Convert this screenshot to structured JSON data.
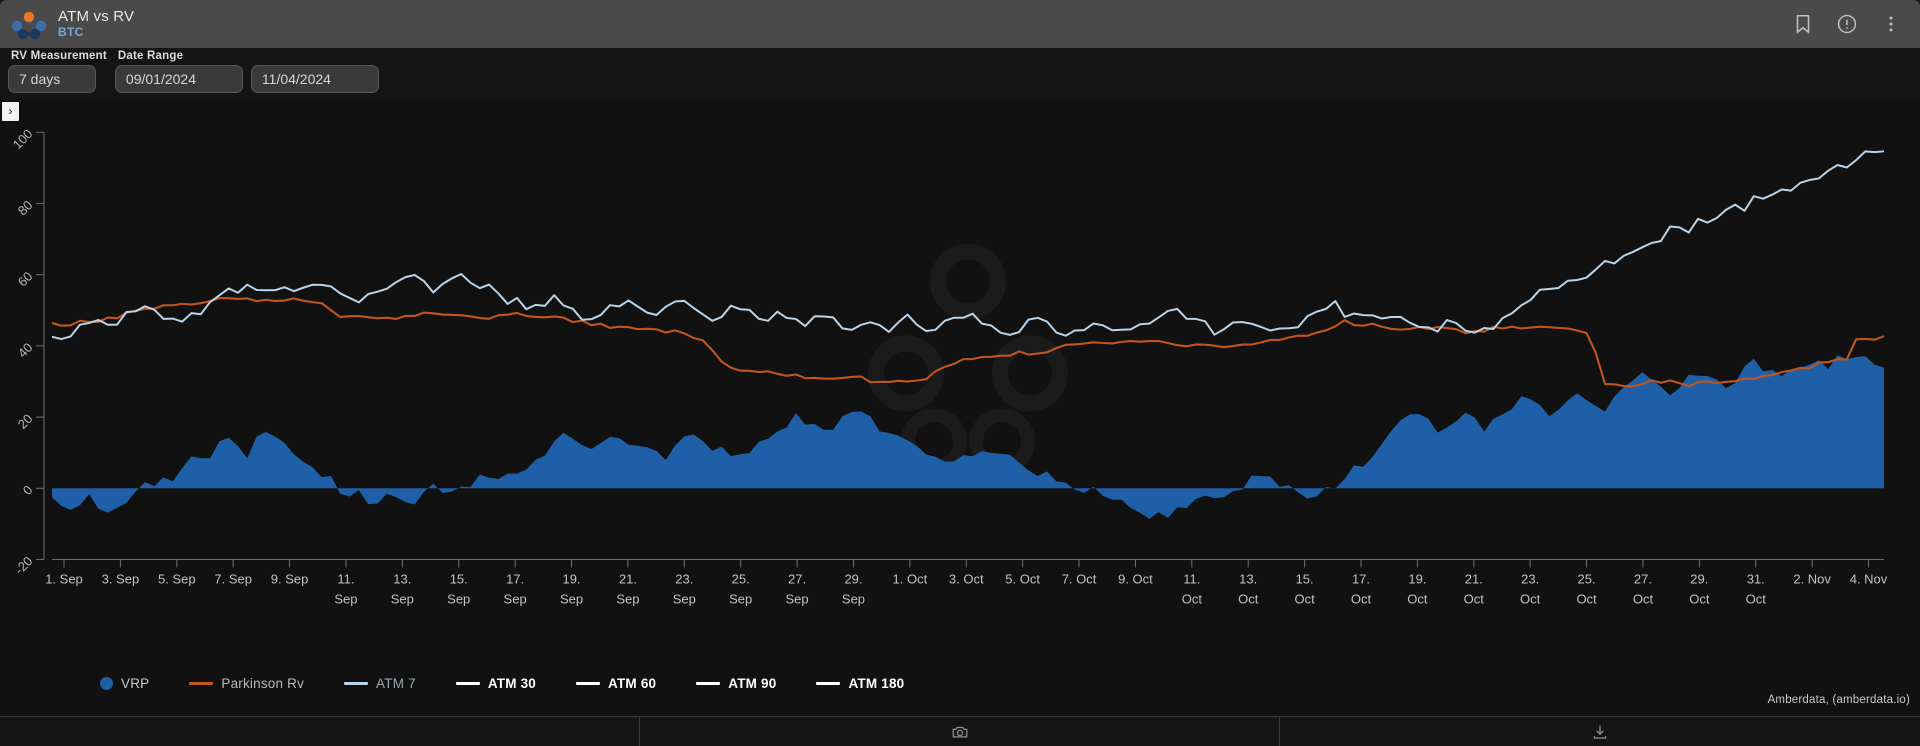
{
  "titlebar": {
    "logo_icon": "amberdata-molecule-logo",
    "title": "ATM vs RV",
    "subtitle": "BTC",
    "actions": [
      {
        "icon": "bookmark-icon",
        "name": "bookmark-button"
      },
      {
        "icon": "alert-circle-icon",
        "name": "info-button"
      },
      {
        "icon": "more-vertical-icon",
        "name": "overflow-menu-button"
      }
    ]
  },
  "controls": {
    "rv_measurement": {
      "label": "RV Measurement",
      "value": "7 days",
      "placeholder": "7 days"
    },
    "date_range": {
      "label": "Date Range",
      "start_value": "09/01/2024",
      "end_value": "11/04/2024",
      "start_placeholder": "MM/DD/YYYY",
      "end_placeholder": "MM/DD/YYYY"
    }
  },
  "panel_expander": {
    "glyph": "›",
    "name": "expand-left-panel"
  },
  "credit": "Amberdata, (amberdata.io)",
  "bottombar": {
    "cells": [
      {
        "name": "status-cell",
        "icon": ""
      },
      {
        "name": "screenshot-button",
        "icon": "camera-icon"
      },
      {
        "name": "download-button",
        "icon": "download-icon"
      }
    ]
  },
  "legend": {
    "position": "bottom-left",
    "items": [
      {
        "label": "VRP",
        "color": "#1f5fa8",
        "marker": "dot",
        "text_color": "#c9c9c9"
      },
      {
        "label": "Parkinson Rv",
        "color": "#c0551f",
        "marker": "line",
        "text_color": "#b8b8b8"
      },
      {
        "label": "ATM 7",
        "color": "#b9d4ea",
        "marker": "line",
        "text_color": "#9aa6ad"
      },
      {
        "label": "ATM 30",
        "color": "#ffffff",
        "marker": "line",
        "text_color": "#ffffff"
      },
      {
        "label": "ATM 60",
        "color": "#ffffff",
        "marker": "line",
        "text_color": "#ffffff"
      },
      {
        "label": "ATM 90",
        "color": "#ffffff",
        "marker": "line",
        "text_color": "#ffffff"
      },
      {
        "label": "ATM 180",
        "color": "#ffffff",
        "marker": "line",
        "text_color": "#ffffff"
      }
    ]
  },
  "chart_data": {
    "type": "line",
    "title": "ATM vs RV",
    "subtitle": "BTC",
    "xlabel": "",
    "ylabel": "",
    "ylim": [
      -28,
      104
    ],
    "yticks": [
      -20,
      0,
      20,
      40,
      60,
      80,
      100
    ],
    "ytick_labels": [
      "-20",
      "0",
      "20",
      "40",
      "60",
      "80",
      "100"
    ],
    "ytick_rotation_deg": -45,
    "grid": false,
    "xtick_labels": [
      "1. Sep",
      "3. Sep",
      "5. Sep",
      "7. Sep",
      "9. Sep",
      "11. Sep",
      "13. Sep",
      "15. Sep",
      "17. Sep",
      "19. Sep",
      "21. Sep",
      "23. Sep",
      "25. Sep",
      "27. Sep",
      "29. Sep",
      "1. Oct",
      "3. Oct",
      "5. Oct",
      "7. Oct",
      "9. Oct",
      "11. Oct",
      "13. Oct",
      "15. Oct",
      "17. Oct",
      "19. Oct",
      "21. Oct",
      "23. Oct",
      "25. Oct",
      "27. Oct",
      "29. Oct",
      "31. Oct",
      "2. Nov",
      "4. Nov"
    ],
    "x_range": [
      "2024-09-01",
      "2024-11-04"
    ],
    "series": [
      {
        "name": "VRP",
        "type": "area",
        "color": "#1f5fa8",
        "baseline": 0,
        "values": [
          -3,
          -4,
          -5,
          -4,
          -3,
          -5,
          -6,
          -4,
          -3,
          -2,
          1,
          2,
          4,
          3,
          5,
          8,
          7,
          9,
          12,
          14,
          11,
          9,
          13,
          16,
          14,
          12,
          10,
          8,
          6,
          4,
          2,
          -1,
          -3,
          -2,
          -4,
          -5,
          -3,
          -2,
          -4,
          -3,
          -1,
          1,
          0,
          -2,
          -1,
          1,
          3,
          2,
          4,
          3,
          5,
          6,
          8,
          10,
          12,
          14,
          13,
          11,
          12,
          14,
          16,
          15,
          13,
          12,
          11,
          10,
          9,
          11,
          13,
          15,
          14,
          12,
          11,
          9,
          8,
          10,
          12,
          14,
          16,
          18,
          20,
          19,
          17,
          16,
          18,
          20,
          22,
          21,
          19,
          17,
          15,
          14,
          13,
          12,
          11,
          10,
          9,
          8,
          9,
          10,
          11,
          10,
          9,
          8,
          7,
          6,
          5,
          4,
          3,
          2,
          1,
          0,
          -1,
          -2,
          -3,
          -4,
          -5,
          -6,
          -7,
          -8,
          -7,
          -6,
          -5,
          -4,
          -3,
          -2,
          -1,
          0,
          1,
          2,
          3,
          2,
          1,
          0,
          -1,
          -2,
          -1,
          0,
          1,
          3,
          5,
          7,
          9,
          12,
          15,
          18,
          20,
          22,
          19,
          17,
          16,
          18,
          20,
          19,
          17,
          19,
          21,
          23,
          25,
          24,
          22,
          21,
          23,
          25,
          27,
          26,
          24,
          23,
          25,
          27,
          29,
          31,
          30,
          28,
          27,
          29,
          31,
          33,
          32,
          30,
          29,
          31,
          33,
          35,
          34,
          32,
          31,
          33,
          35,
          34,
          36,
          35,
          37,
          36,
          38,
          37,
          36,
          35
        ]
      },
      {
        "name": "Parkinson Rv",
        "type": "line",
        "color": "#c0551f",
        "values": [
          46,
          46,
          46,
          47,
          47,
          47,
          48,
          48,
          49,
          50,
          50,
          50,
          51,
          51,
          52,
          52,
          52,
          52,
          53,
          53,
          53,
          53,
          53,
          53,
          53,
          53,
          53,
          53,
          53,
          52,
          52,
          48,
          48,
          48,
          48,
          48,
          48,
          48,
          48,
          48,
          49,
          49,
          49,
          49,
          49,
          49,
          48,
          48,
          48,
          49,
          49,
          49,
          48,
          48,
          48,
          48,
          48,
          47,
          47,
          46,
          46,
          45,
          45,
          45,
          45,
          45,
          45,
          44,
          44,
          44,
          43,
          42,
          41,
          37,
          34,
          33,
          33,
          33,
          33,
          32,
          32,
          32,
          32,
          31,
          31,
          31,
          31,
          31,
          31,
          31,
          30,
          30,
          30,
          30,
          30,
          30,
          31,
          33,
          34,
          35,
          36,
          36,
          37,
          37,
          37,
          37,
          38,
          38,
          38,
          38,
          39,
          40,
          40,
          40,
          41,
          41,
          41,
          41,
          41,
          41,
          41,
          41,
          41,
          40,
          40,
          40,
          40,
          40,
          40,
          40,
          40,
          40,
          41,
          41,
          42,
          42,
          43,
          43,
          43,
          44,
          45,
          46,
          47,
          46,
          46,
          46,
          45,
          45,
          45,
          45,
          45,
          45,
          45,
          45,
          45,
          44,
          44,
          44,
          45,
          45,
          45,
          45,
          45,
          45,
          45,
          45,
          45,
          44,
          44,
          44,
          29,
          29,
          29,
          29,
          29,
          30,
          30,
          30,
          30,
          29,
          29,
          30,
          30,
          30,
          30,
          30,
          31,
          31,
          32,
          32,
          33,
          33,
          34,
          34,
          35,
          35,
          36,
          36,
          42,
          42,
          42,
          43
        ]
      },
      {
        "name": "ATM 7",
        "type": "line",
        "color": "#b9d4ea",
        "values": [
          42,
          42,
          43,
          45,
          46,
          48,
          47,
          46,
          48,
          50,
          51,
          50,
          49,
          47,
          48,
          49,
          50,
          51,
          53,
          55,
          56,
          57,
          55,
          54,
          56,
          58,
          57,
          56,
          58,
          59,
          58,
          57,
          55,
          54,
          53,
          55,
          56,
          57,
          59,
          60,
          58,
          57,
          56,
          58,
          59,
          60,
          58,
          57,
          56,
          54,
          53,
          52,
          51,
          50,
          52,
          53,
          51,
          50,
          49,
          48,
          49,
          50,
          52,
          53,
          51,
          50,
          49,
          51,
          53,
          52,
          50,
          49,
          48,
          47,
          49,
          51,
          50,
          48,
          47,
          49,
          50,
          48,
          47,
          46,
          48,
          49,
          47,
          46,
          45,
          47,
          48,
          46,
          45,
          47,
          48,
          46,
          45,
          46,
          47,
          48,
          49,
          48,
          47,
          46,
          45,
          44,
          45,
          46,
          47,
          46,
          45,
          44,
          43,
          44,
          45,
          46,
          45,
          44,
          45,
          46,
          47,
          48,
          49,
          50,
          48,
          47,
          46,
          45,
          44,
          45,
          46,
          47,
          46,
          45,
          44,
          45,
          46,
          47,
          48,
          50,
          52,
          51,
          49,
          48,
          47,
          48,
          49,
          48,
          47,
          46,
          45,
          44,
          45,
          46,
          45,
          44,
          43,
          44,
          45,
          47,
          49,
          51,
          53,
          55,
          54,
          56,
          58,
          60,
          59,
          61,
          63,
          65,
          64,
          66,
          68,
          70,
          69,
          71,
          73,
          72,
          74,
          76,
          75,
          77,
          79,
          78,
          80,
          82,
          81,
          83,
          85,
          84,
          86,
          88,
          87,
          89,
          91,
          90,
          92,
          94,
          93,
          95
        ]
      }
    ],
    "notes": "VRP rendered as filled area around zero baseline; Parkinson Rv and ATM 7 as step/jagged lines. ATM 30/60/90/180 present in legend but not plotted."
  }
}
